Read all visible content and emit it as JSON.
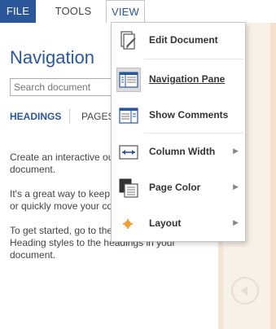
{
  "menubar": {
    "file": "FILE",
    "tools": "TOOLS",
    "view": "VIEW"
  },
  "nav_pane": {
    "title": "Navigation",
    "search_placeholder": "Search document",
    "tabs": [
      "HEADINGS",
      "PAGES"
    ],
    "paragraphs": [
      "Create an interactive ou",
      "document.",
      "It's a great way to keep t",
      "or quickly move your co",
      "To get started, go to the",
      "Heading styles to the headings in your",
      "document."
    ]
  },
  "view_menu": {
    "items": [
      {
        "label": "Edit Document",
        "icon": "edit-document-icon",
        "submenu": false
      },
      {
        "label": "Navigation Pane",
        "icon": "navigation-pane-icon",
        "submenu": false,
        "selected": true
      },
      {
        "label": "Show Comments",
        "icon": "show-comments-icon",
        "submenu": false
      },
      {
        "label": "Column Width",
        "icon": "column-width-icon",
        "submenu": true
      },
      {
        "label": "Page Color",
        "icon": "page-color-icon",
        "submenu": true
      },
      {
        "label": "Layout",
        "icon": "layout-icon",
        "submenu": true
      }
    ]
  },
  "colors": {
    "accent": "#2b579a",
    "doc_background": "#f8f1e8",
    "layout_dot": "#f0a030"
  }
}
